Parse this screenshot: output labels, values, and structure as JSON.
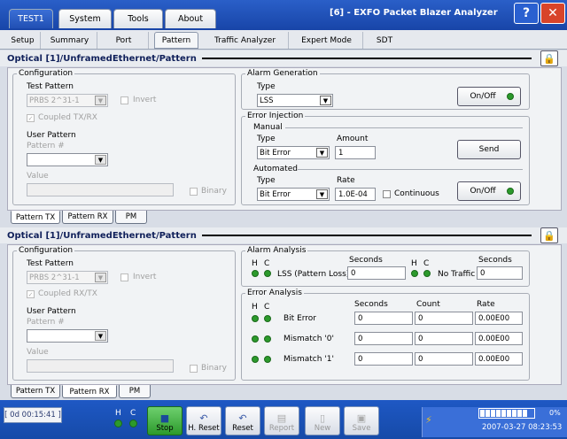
{
  "top_tabs": [
    "TEST1",
    "System",
    "Tools",
    "About"
  ],
  "window_title": "[6] - EXFO Packet Blazer Analyzer",
  "help_label": "?",
  "close_label": "✕",
  "sub_tabs": [
    "Setup",
    "Summary",
    "Port",
    "Pattern",
    "Traffic Analyzer",
    "Expert Mode",
    "SDT"
  ],
  "tx": {
    "header": "Optical [1]/UnframedEthernet/Pattern",
    "configuration_legend": "Configuration",
    "test_pattern_label": "Test Pattern",
    "test_pattern_value": "PRBS 2^31-1",
    "invert_label": "Invert",
    "coupled_label": "Coupled TX/RX",
    "user_pattern_label": "User Pattern",
    "pattern_num_label": "Pattern #",
    "value_label": "Value",
    "binary_label": "Binary",
    "alarm_gen_legend": "Alarm Generation",
    "alarm_type_label": "Type",
    "alarm_type_value": "LSS",
    "onoff_label": "On/Off",
    "error_inj_legend": "Error Injection",
    "manual_legend": "Manual",
    "manual_type_label": "Type",
    "manual_type_value": "Bit Error",
    "amount_label": "Amount",
    "amount_value": "1",
    "send_label": "Send",
    "automated_legend": "Automated",
    "auto_type_label": "Type",
    "auto_type_value": "Bit Error",
    "rate_label": "Rate",
    "rate_value": "1.0E-04",
    "continuous_label": "Continuous",
    "onoff2_label": "On/Off"
  },
  "tabs_tx": [
    "Pattern TX",
    "Pattern RX",
    "PM"
  ],
  "rx": {
    "header": "Optical [1]/UnframedEthernet/Pattern",
    "configuration_legend": "Configuration",
    "test_pattern_label": "Test Pattern",
    "test_pattern_value": "PRBS 2^31-1",
    "invert_label": "Invert",
    "coupled_label": "Coupled RX/TX",
    "user_pattern_label": "User Pattern",
    "pattern_num_label": "Pattern #",
    "value_label": "Value",
    "binary_label": "Binary",
    "alarm_analysis_legend": "Alarm Analysis",
    "h": "H",
    "c": "C",
    "seconds_label": "Seconds",
    "lss_label": "LSS (Pattern Loss)",
    "lss_seconds": "0",
    "no_traffic_label": "No Traffic",
    "no_traffic_seconds": "0",
    "error_analysis_legend": "Error Analysis",
    "count_label": "Count",
    "rate_label": "Rate",
    "rows": [
      {
        "label": "Bit Error",
        "seconds": "0",
        "count": "0",
        "rate": "0.00E00"
      },
      {
        "label": "Mismatch '0'",
        "seconds": "0",
        "count": "0",
        "rate": "0.00E00"
      },
      {
        "label": "Mismatch '1'",
        "seconds": "0",
        "count": "0",
        "rate": "0.00E00"
      }
    ]
  },
  "tabs_rx": [
    "Pattern TX",
    "Pattern RX",
    "PM"
  ],
  "status": {
    "timer": "[ 0d 00:15:41 ]",
    "h": "H",
    "c": "C",
    "tools": [
      "Stop",
      "H. Reset",
      "Reset",
      "Report",
      "New",
      "Save"
    ],
    "battery_pct": "0%",
    "datetime": "2007-03-27 08:23:53"
  },
  "colors": {
    "title_blue": "#1845a8",
    "led_green": "#2c9a2c"
  }
}
